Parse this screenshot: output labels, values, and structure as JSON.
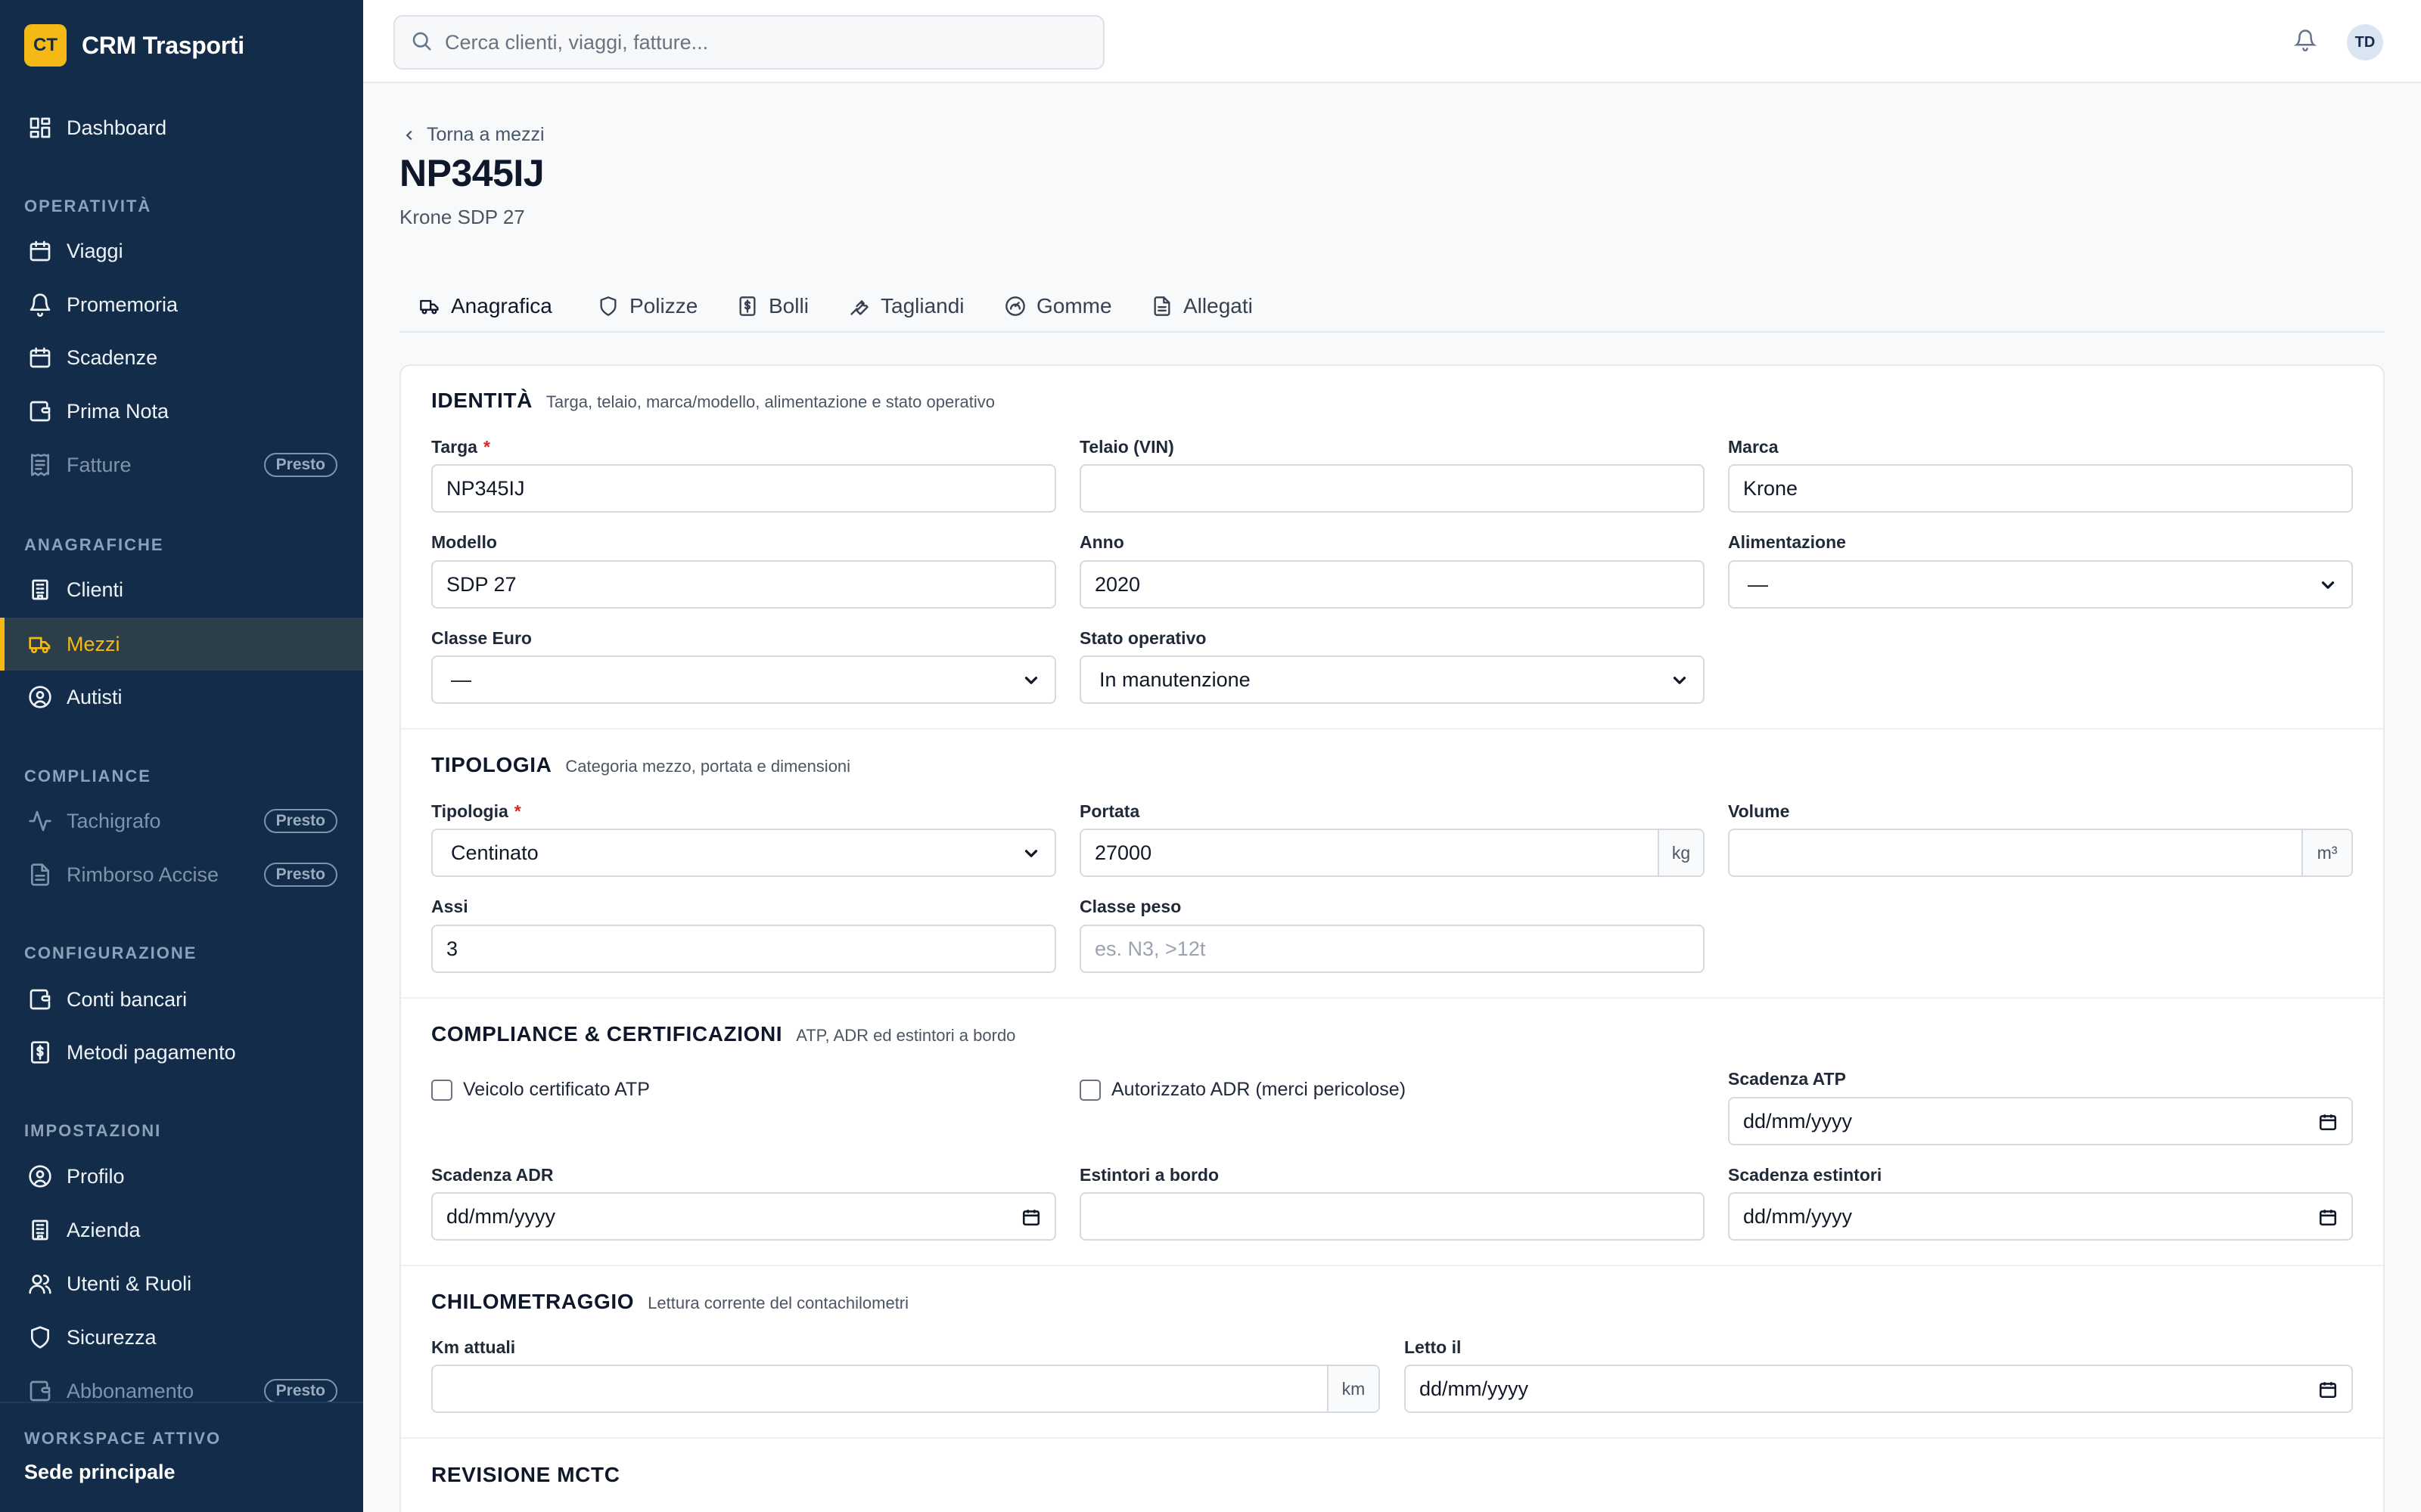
{
  "app": {
    "logo": "CT",
    "name": "CRM Trasporti"
  },
  "sidebar": {
    "dashboard": "Dashboard",
    "sections": {
      "operativita": "OPERATIVITÀ",
      "anagrafiche": "ANAGRAFICHE",
      "compliance": "COMPLIANCE",
      "configurazione": "CONFIGURAZIONE",
      "impostazioni": "IMPOSTAZIONI"
    },
    "items": {
      "viaggi": "Viaggi",
      "promemoria": "Promemoria",
      "scadenze": "Scadenze",
      "prima_nota": "Prima Nota",
      "fatture": "Fatture",
      "clienti": "Clienti",
      "mezzi": "Mezzi",
      "autisti": "Autisti",
      "tachigrafo": "Tachigrafo",
      "rimborso_accise": "Rimborso Accise",
      "conti_bancari": "Conti bancari",
      "metodi_pagamento": "Metodi pagamento",
      "profilo": "Profilo",
      "azienda": "Azienda",
      "utenti_ruoli": "Utenti & Ruoli",
      "sicurezza": "Sicurezza",
      "abbonamento": "Abbonamento"
    },
    "badge": "Presto",
    "workspace_label": "WORKSPACE ATTIVO",
    "workspace_name": "Sede principale",
    "accent_color": "#f5b915"
  },
  "topbar": {
    "search_placeholder": "Cerca clienti, viaggi, fatture...",
    "user_initials": "TD"
  },
  "page": {
    "back": "Torna a mezzi",
    "title": "NP345IJ",
    "subtitle": "Krone SDP 27",
    "tabs": [
      "Anagrafica",
      "Polizze",
      "Bolli",
      "Tagliandi",
      "Gomme",
      "Allegati"
    ]
  },
  "identita": {
    "title": "IDENTITÀ",
    "desc": "Targa, telaio, marca/modello, alimentazione e stato operativo",
    "targa_label": "Targa",
    "targa_value": "NP345IJ",
    "telaio_label": "Telaio (VIN)",
    "telaio_value": "",
    "marca_label": "Marca",
    "marca_value": "Krone",
    "modello_label": "Modello",
    "modello_value": "SDP 27",
    "anno_label": "Anno",
    "anno_value": "2020",
    "alimentazione_label": "Alimentazione",
    "alimentazione_value": "—",
    "classe_euro_label": "Classe Euro",
    "classe_euro_value": "—",
    "stato_label": "Stato operativo",
    "stato_value": "In manutenzione"
  },
  "tipologia": {
    "title": "TIPOLOGIA",
    "desc": "Categoria mezzo, portata e dimensioni",
    "tipologia_label": "Tipologia",
    "tipologia_value": "Centinato",
    "portata_label": "Portata",
    "portata_value": "27000",
    "portata_unit": "kg",
    "volume_label": "Volume",
    "volume_value": "",
    "volume_unit": "m³",
    "assi_label": "Assi",
    "assi_value": "3",
    "classe_peso_label": "Classe peso",
    "classe_peso_placeholder": "es. N3, >12t"
  },
  "compliance": {
    "title": "COMPLIANCE & CERTIFICAZIONI",
    "desc": "ATP, ADR ed estintori a bordo",
    "atp_check": "Veicolo certificato ATP",
    "adr_check": "Autorizzato ADR (merci pericolose)",
    "scadenza_atp_label": "Scadenza ATP",
    "scadenza_adr_label": "Scadenza ADR",
    "estintori_label": "Estintori a bordo",
    "scadenza_estintori_label": "Scadenza estintori",
    "date_placeholder": "dd/mm/yyyy"
  },
  "chilometraggio": {
    "title": "CHILOMETRAGGIO",
    "desc": "Lettura corrente del contachilometri",
    "km_label": "Km attuali",
    "km_unit": "km",
    "letto_label": "Letto il",
    "date_placeholder": "dd/mm/yyyy"
  },
  "revisione": {
    "title": "REVISIONE MCTC"
  }
}
